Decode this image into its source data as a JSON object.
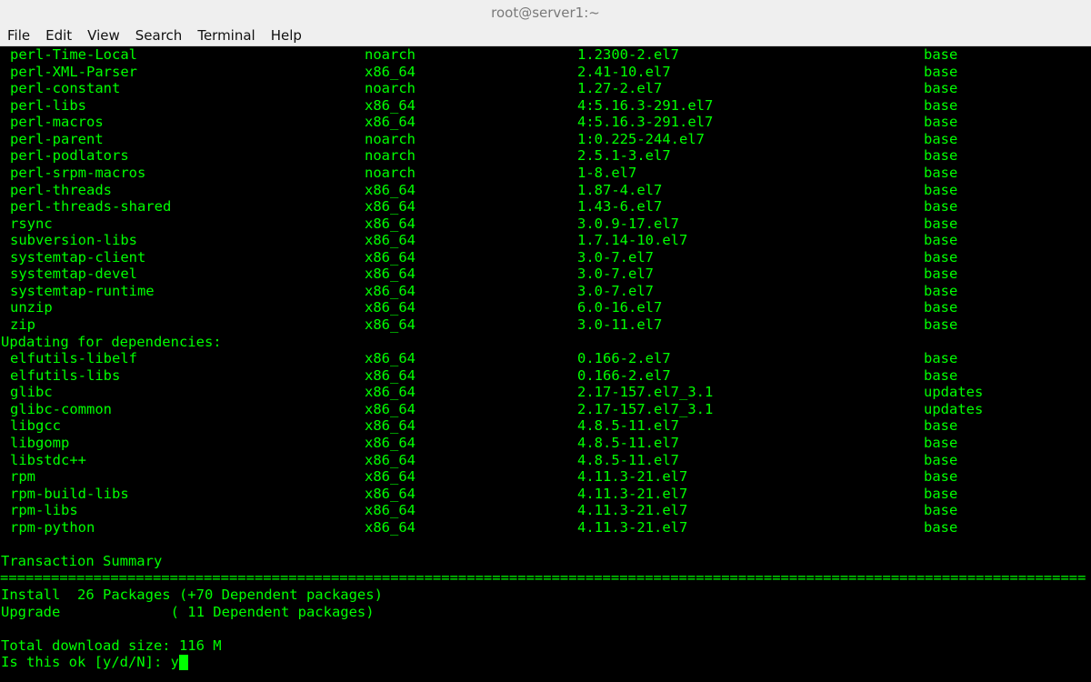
{
  "window": {
    "title": "root@server1:~"
  },
  "menu": [
    "File",
    "Edit",
    "View",
    "Search",
    "Terminal",
    "Help"
  ],
  "packages": [
    [
      "perl-Time-Local",
      "noarch",
      "1.2300-2.el7",
      "base"
    ],
    [
      "perl-XML-Parser",
      "x86_64",
      "2.41-10.el7",
      "base"
    ],
    [
      "perl-constant",
      "noarch",
      "1.27-2.el7",
      "base"
    ],
    [
      "perl-libs",
      "x86_64",
      "4:5.16.3-291.el7",
      "base"
    ],
    [
      "perl-macros",
      "x86_64",
      "4:5.16.3-291.el7",
      "base"
    ],
    [
      "perl-parent",
      "noarch",
      "1:0.225-244.el7",
      "base"
    ],
    [
      "perl-podlators",
      "noarch",
      "2.5.1-3.el7",
      "base"
    ],
    [
      "perl-srpm-macros",
      "noarch",
      "1-8.el7",
      "base"
    ],
    [
      "perl-threads",
      "x86_64",
      "1.87-4.el7",
      "base"
    ],
    [
      "perl-threads-shared",
      "x86_64",
      "1.43-6.el7",
      "base"
    ],
    [
      "rsync",
      "x86_64",
      "3.0.9-17.el7",
      "base"
    ],
    [
      "subversion-libs",
      "x86_64",
      "1.7.14-10.el7",
      "base"
    ],
    [
      "systemtap-client",
      "x86_64",
      "3.0-7.el7",
      "base"
    ],
    [
      "systemtap-devel",
      "x86_64",
      "3.0-7.el7",
      "base"
    ],
    [
      "systemtap-runtime",
      "x86_64",
      "3.0-7.el7",
      "base"
    ],
    [
      "unzip",
      "x86_64",
      "6.0-16.el7",
      "base"
    ],
    [
      "zip",
      "x86_64",
      "3.0-11.el7",
      "base"
    ]
  ],
  "updating_header": "Updating for dependencies:",
  "updating": [
    [
      "elfutils-libelf",
      "x86_64",
      "0.166-2.el7",
      "base"
    ],
    [
      "elfutils-libs",
      "x86_64",
      "0.166-2.el7",
      "base"
    ],
    [
      "glibc",
      "x86_64",
      "2.17-157.el7_3.1",
      "updates"
    ],
    [
      "glibc-common",
      "x86_64",
      "2.17-157.el7_3.1",
      "updates"
    ],
    [
      "libgcc",
      "x86_64",
      "4.8.5-11.el7",
      "base"
    ],
    [
      "libgomp",
      "x86_64",
      "4.8.5-11.el7",
      "base"
    ],
    [
      "libstdc++",
      "x86_64",
      "4.8.5-11.el7",
      "base"
    ],
    [
      "rpm",
      "x86_64",
      "4.11.3-21.el7",
      "base"
    ],
    [
      "rpm-build-libs",
      "x86_64",
      "4.11.3-21.el7",
      "base"
    ],
    [
      "rpm-libs",
      "x86_64",
      "4.11.3-21.el7",
      "base"
    ],
    [
      "rpm-python",
      "x86_64",
      "4.11.3-21.el7",
      "base"
    ]
  ],
  "summary": {
    "title": "Transaction Summary",
    "separator": "================================================================================================================================",
    "install_line": "Install  26 Packages (+70 Dependent packages)",
    "upgrade_line": "Upgrade             ( 11 Dependent packages)",
    "download_line": "Total download size: 116 M",
    "prompt": "Is this ok [y/d/N]: ",
    "input": "y"
  },
  "colors": {
    "terminal_text": "#00ff00",
    "terminal_bg": "#000000",
    "chrome_bg": "#efefef"
  }
}
